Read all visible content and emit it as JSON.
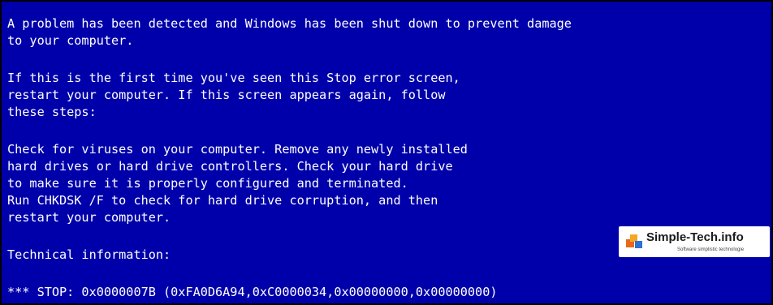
{
  "colors": {
    "background": "#0000aa",
    "text": "#ffffff"
  },
  "bsod": {
    "line1": "A problem has been detected and Windows has been shut down to prevent damage",
    "line2": "to your computer.",
    "line3": "If this is the first time you've seen this Stop error screen,",
    "line4": "restart your computer. If this screen appears again, follow",
    "line5": "these steps:",
    "line6": "Check for viruses on your computer. Remove any newly installed",
    "line7": "hard drives or hard drive controllers. Check your hard drive",
    "line8": "to make sure it is properly configured and terminated.",
    "line9": "Run CHKDSK /F to check for hard drive corruption, and then",
    "line10": "restart your computer.",
    "line11": "Technical information:",
    "line12": "*** STOP: 0x0000007B (0xFA0D6A94,0xC0000034,0x00000000,0x00000000)"
  },
  "watermark": {
    "title": "Simple-Tech.info",
    "subtitle": "Software simplistic technologie",
    "icon": "simple-tech-logo-icon"
  }
}
